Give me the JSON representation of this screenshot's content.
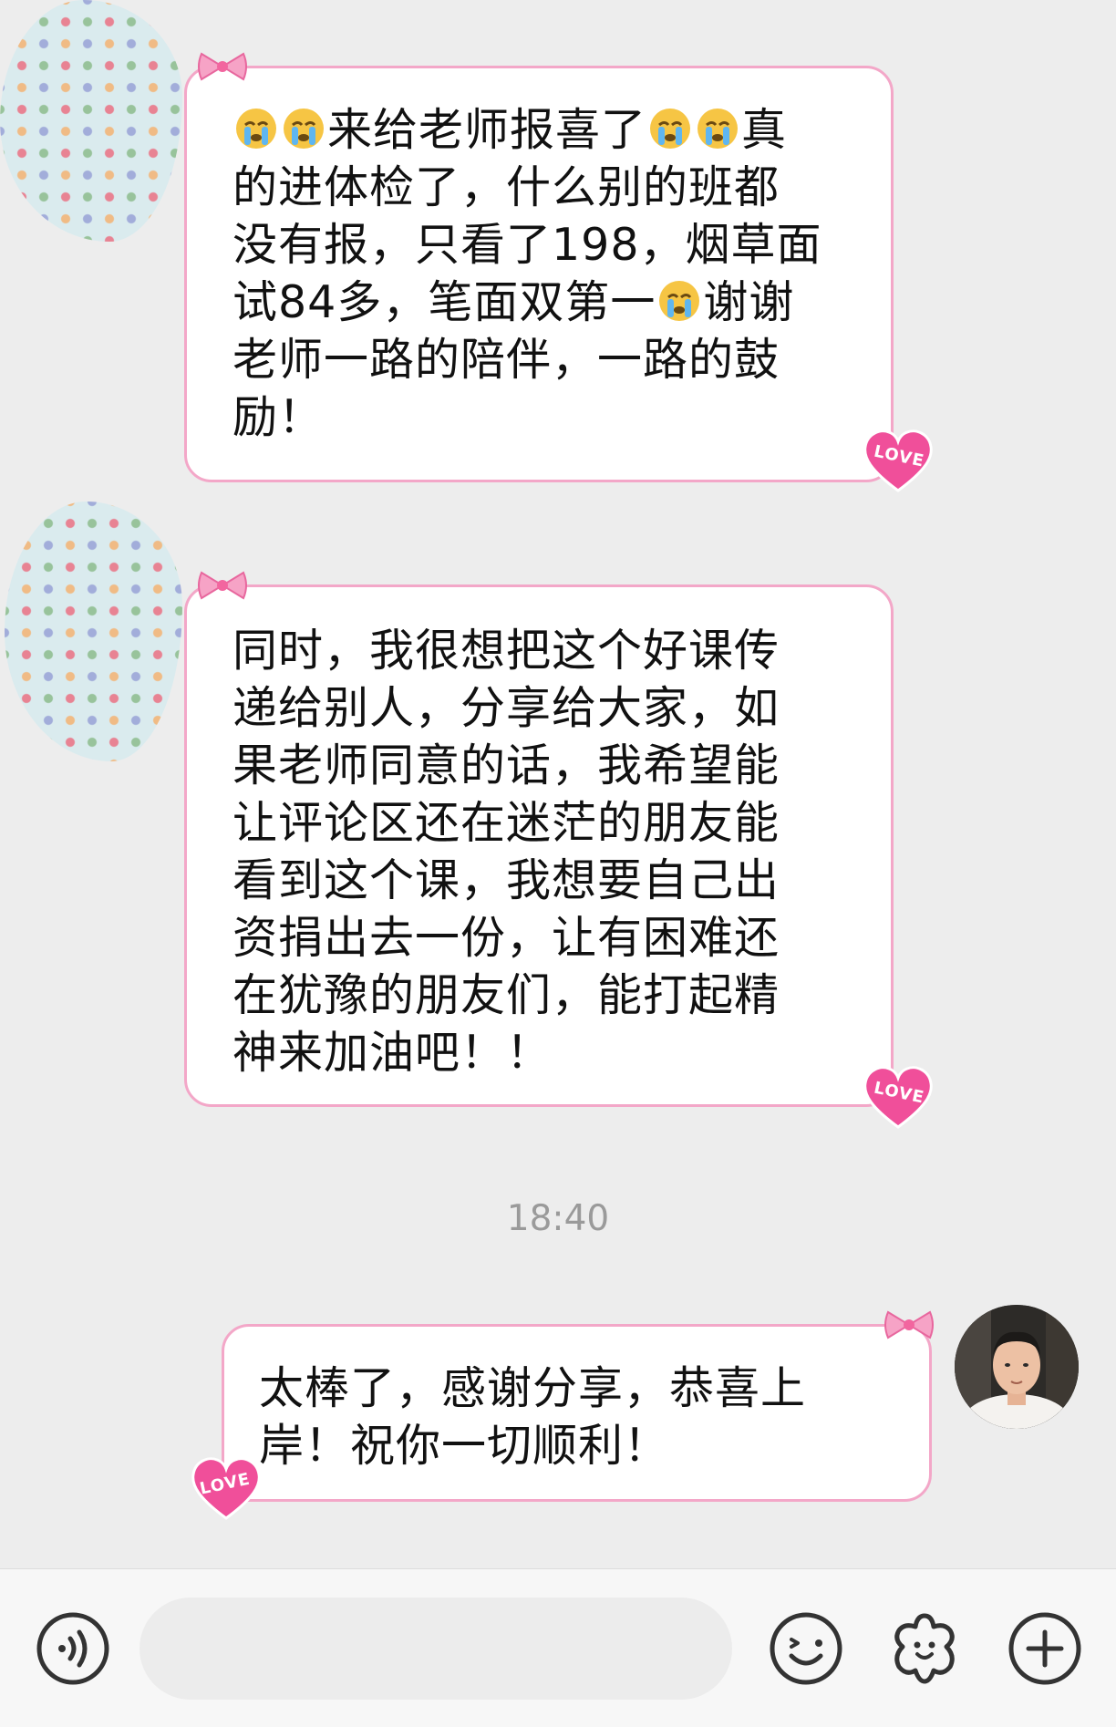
{
  "messages": [
    {
      "side": "received",
      "lines": [
        "来给老师报喜了",
        "真",
        "的进体检了，什么别的班都",
        "没有报，只看了198，烟草面",
        "试84多，笔面双第一",
        "谢谢",
        "老师一路的陪伴，一路的鼓",
        "励！"
      ]
    },
    {
      "side": "received",
      "text": "同时，我很想把这个好课传\n递给别人，分享给大家，如\n果老师同意的话，我希望能\n让评论区还在迷茫的朋友能\n看到这个课，我想要自己出\n资捐出去一份，让有困难还\n在犹豫的朋友们，能打起精\n神来加油吧！！"
    },
    {
      "side": "sent",
      "text": "太棒了，感谢分享，恭喜上\n岸！祝你一切顺利！"
    }
  ],
  "timestamp": "18:40",
  "bubble_decor": {
    "corner_heart_text": "LOVE"
  },
  "input": {
    "placeholder": ""
  },
  "colors": {
    "bubble_border": "#f3a7c8",
    "heart": "#f04f9a",
    "background": "#ededed"
  },
  "icons": [
    "voice-icon",
    "emoji-icon",
    "sticker-icon",
    "add-icon"
  ]
}
